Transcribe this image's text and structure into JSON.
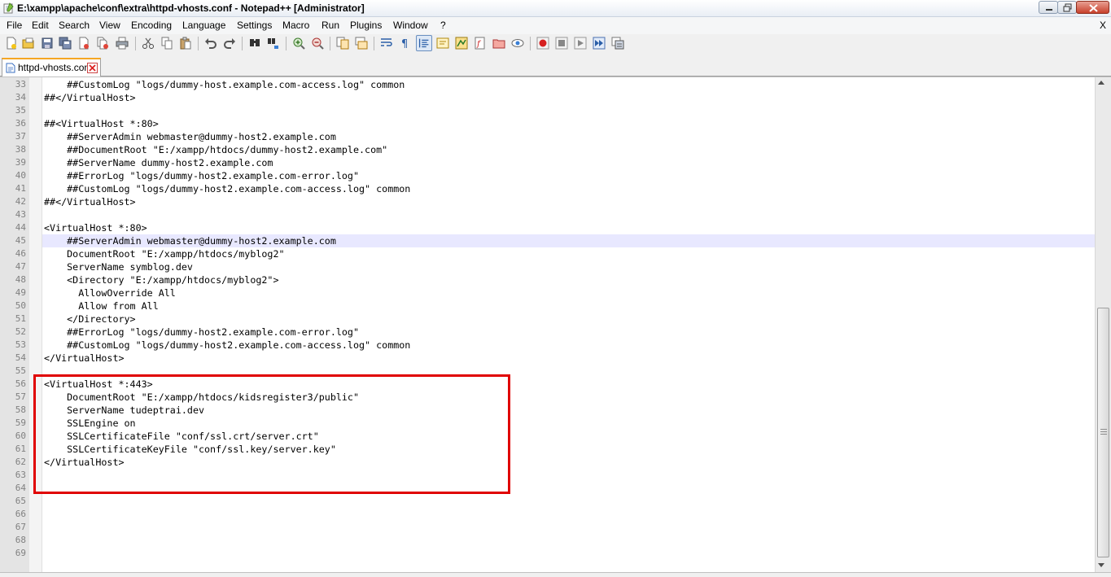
{
  "window": {
    "title": "E:\\xampp\\apache\\conf\\extra\\httpd-vhosts.conf - Notepad++ [Administrator]"
  },
  "menu": {
    "items": [
      "File",
      "Edit",
      "Search",
      "View",
      "Encoding",
      "Language",
      "Settings",
      "Macro",
      "Run",
      "Plugins",
      "Window",
      "?"
    ],
    "close_doc": "X"
  },
  "toolbar": {
    "buttons": [
      "new-file",
      "open-file",
      "save",
      "save-all",
      "close",
      "close-all",
      "print",
      "cut",
      "copy",
      "paste",
      "undo",
      "redo",
      "find",
      "replace",
      "zoom-in",
      "zoom-out",
      "sync-vertical",
      "sync-horizontal",
      "word-wrap",
      "show-all-chars",
      "indent-guide",
      "user-defined-lang",
      "doc-map",
      "function-list",
      "folder-as-workspace",
      "monitoring",
      "record-macro",
      "stop-record",
      "play-macro",
      "run-macro-multiple",
      "save-macro"
    ]
  },
  "tabs": [
    {
      "label": "httpd-vhosts.conf",
      "active": true
    }
  ],
  "editor": {
    "current_line": 45,
    "lines": [
      {
        "num": "33",
        "text": "    ##CustomLog \"logs/dummy-host.example.com-access.log\" common"
      },
      {
        "num": "34",
        "text": "##</VirtualHost>"
      },
      {
        "num": "35",
        "text": ""
      },
      {
        "num": "36",
        "text": "##<VirtualHost *:80>"
      },
      {
        "num": "37",
        "text": "    ##ServerAdmin webmaster@dummy-host2.example.com"
      },
      {
        "num": "38",
        "text": "    ##DocumentRoot \"E:/xampp/htdocs/dummy-host2.example.com\""
      },
      {
        "num": "39",
        "text": "    ##ServerName dummy-host2.example.com"
      },
      {
        "num": "40",
        "text": "    ##ErrorLog \"logs/dummy-host2.example.com-error.log\""
      },
      {
        "num": "41",
        "text": "    ##CustomLog \"logs/dummy-host2.example.com-access.log\" common"
      },
      {
        "num": "42",
        "text": "##</VirtualHost>"
      },
      {
        "num": "43",
        "text": ""
      },
      {
        "num": "44",
        "text": "<VirtualHost *:80>"
      },
      {
        "num": "45",
        "text": "    ##ServerAdmin webmaster@dummy-host2.example.com"
      },
      {
        "num": "46",
        "text": "    DocumentRoot \"E:/xampp/htdocs/myblog2\""
      },
      {
        "num": "47",
        "text": "    ServerName symblog.dev"
      },
      {
        "num": "48",
        "text": "    <Directory \"E:/xampp/htdocs/myblog2\">"
      },
      {
        "num": "49",
        "text": "      AllowOverride All"
      },
      {
        "num": "50",
        "text": "      Allow from All"
      },
      {
        "num": "51",
        "text": "    </Directory>"
      },
      {
        "num": "52",
        "text": "    ##ErrorLog \"logs/dummy-host2.example.com-error.log\""
      },
      {
        "num": "53",
        "text": "    ##CustomLog \"logs/dummy-host2.example.com-access.log\" common"
      },
      {
        "num": "54",
        "text": "</VirtualHost>"
      },
      {
        "num": "55",
        "text": ""
      },
      {
        "num": "56",
        "text": "<VirtualHost *:443>"
      },
      {
        "num": "57",
        "text": "    DocumentRoot \"E:/xampp/htdocs/kidsregister3/public\""
      },
      {
        "num": "58",
        "text": "    ServerName tudeptrai.dev"
      },
      {
        "num": "59",
        "text": "    SSLEngine on"
      },
      {
        "num": "60",
        "text": "    SSLCertificateFile \"conf/ssl.crt/server.crt\""
      },
      {
        "num": "61",
        "text": "    SSLCertificateKeyFile \"conf/ssl.key/server.key\""
      },
      {
        "num": "62",
        "text": "</VirtualHost>"
      },
      {
        "num": "63",
        "text": ""
      },
      {
        "num": "64",
        "text": ""
      },
      {
        "num": "65",
        "text": ""
      },
      {
        "num": "66",
        "text": ""
      },
      {
        "num": "67",
        "text": ""
      },
      {
        "num": "68",
        "text": ""
      },
      {
        "num": "69",
        "text": ""
      }
    ]
  },
  "colors": {
    "highlight_box": "#e00000",
    "current_line": "#e8e8ff",
    "gutter": "#e4e4e4"
  }
}
